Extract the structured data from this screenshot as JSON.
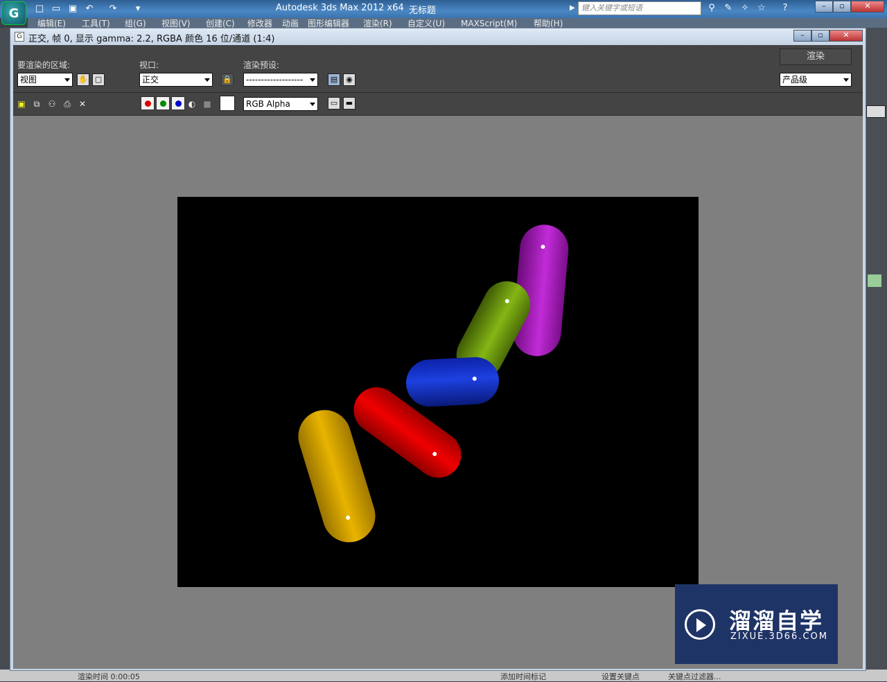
{
  "max": {
    "app_title": "Autodesk 3ds Max  2012 x64",
    "doc_title": "无标题",
    "search_placeholder": "键入关键字或短语",
    "menu": [
      "编辑(E)",
      "工具(T)",
      "组(G)",
      "视图(V)",
      "创建(C)",
      "修改器",
      "动画",
      "图形编辑器",
      "渲染(R)",
      "自定义(U)",
      "MAXScript(M)",
      "帮助(H)"
    ],
    "status_left": "渲染时间 0:00:05",
    "status_mid": "添加时间标记",
    "status_right1": "设置关键点",
    "status_right2": "关键点过滤器..."
  },
  "frame": {
    "title": "正交, 帧 0, 显示 gamma: 2.2, RGBA 颜色 16 位/通道 (1:4)",
    "area_label": "要渲染的区域:",
    "area_value": "视图",
    "viewport_label": "视口:",
    "viewport_value": "正交",
    "preset_label": "渲染预设:",
    "preset_value": "-------------------",
    "render_button": "渲染",
    "quality_value": "产品级",
    "channel_value": "RGB Alpha"
  },
  "scene": {
    "objects": [
      "magenta-capsule",
      "green-capsule",
      "blue-capsule",
      "red-capsule",
      "yellow-capsule"
    ],
    "colors": {
      "magenta": "#b01fc4",
      "green": "#6e9a10",
      "blue": "#1430c8",
      "red": "#d80000",
      "yellow": "#d9a800"
    }
  },
  "watermark": {
    "title": "溜溜自学",
    "subtitle": "ZIXUE.3D66.COM"
  }
}
